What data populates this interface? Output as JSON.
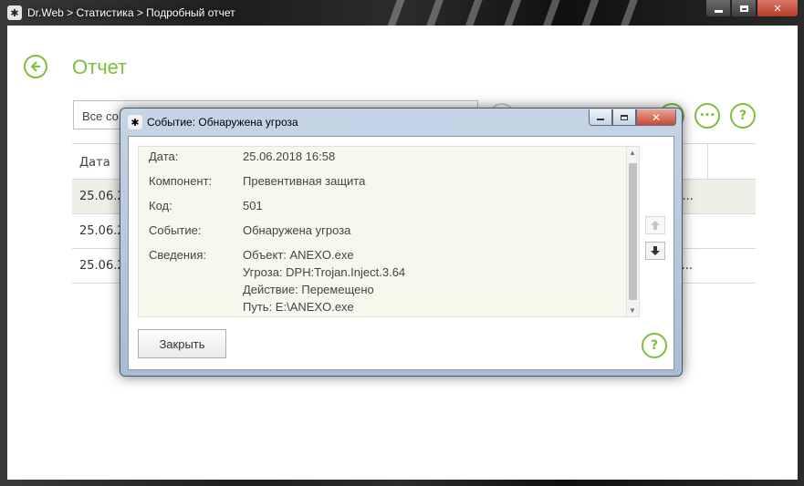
{
  "window": {
    "title": "Dr.Web > Статистика > Подробный отчет",
    "app_icon": "drweb-spider-icon"
  },
  "page": {
    "title": "Отчет",
    "filter_value": "Все со",
    "help_label": "?",
    "more_label": "•••"
  },
  "table": {
    "columns": [
      "Дата"
    ],
    "rows": [
      {
        "date": "25.06.2",
        "tail": "н...",
        "selected": true
      },
      {
        "date": "25.06.2",
        "tail": "",
        "selected": false
      },
      {
        "date": "25.06.2",
        "tail": "в...",
        "selected": false
      }
    ]
  },
  "dialog": {
    "title": "Событие: Обнаружена угроза",
    "fields": {
      "date_label": "Дата:",
      "date_value": "25.06.2018 16:58",
      "component_label": "Компонент:",
      "component_value": "Превентивная защита",
      "code_label": "Код:",
      "code_value": "501",
      "event_label": "Событие:",
      "event_value": "Обнаружена угроза",
      "info_label": "Сведения:",
      "info_lines": [
        "Объект: ANEXO.exe",
        "Угроза: DPH:Trojan.Inject.3.64",
        "Действие: Перемещено",
        "Путь: E:\\ANEXO.exe"
      ]
    },
    "close_button": "Закрыть",
    "help_label": "?"
  },
  "colors": {
    "accent": "#7cc13e",
    "details_bg": "#f7f7ee",
    "selected_row": "#eef0e8"
  }
}
